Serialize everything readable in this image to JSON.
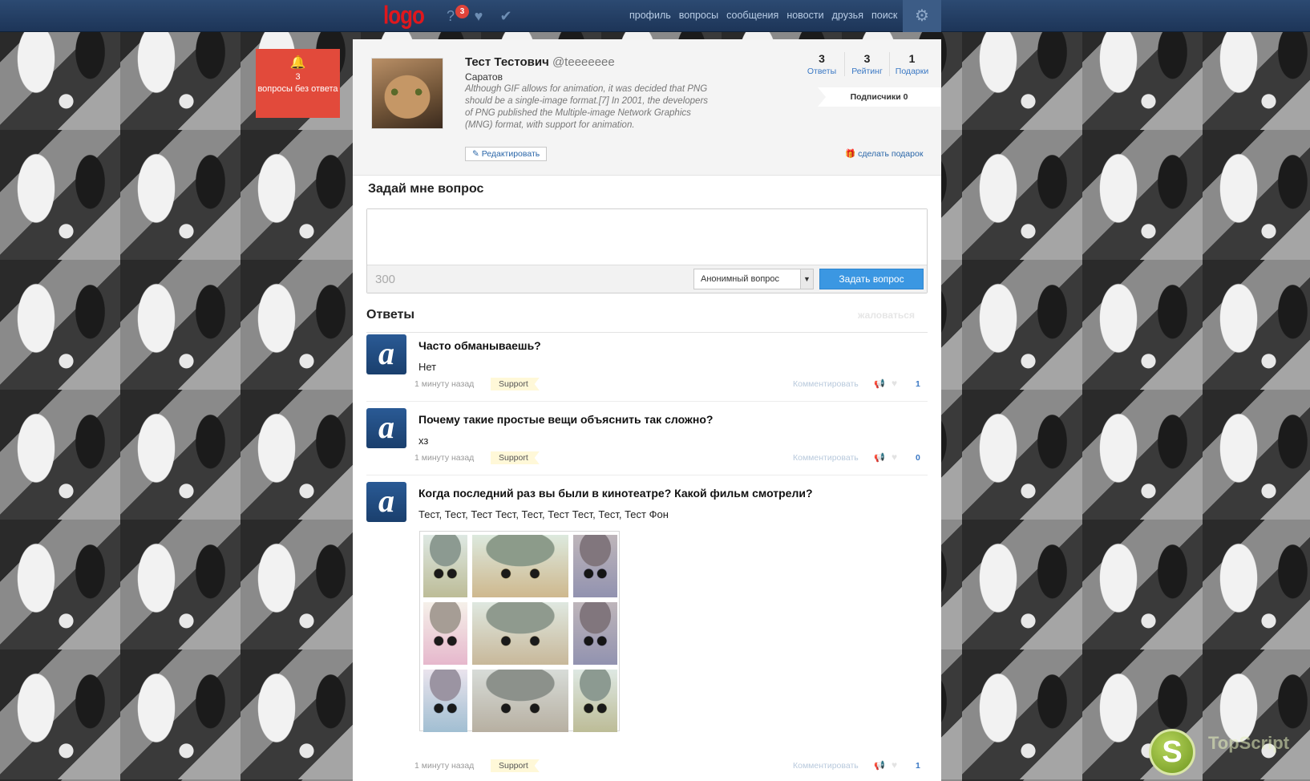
{
  "header": {
    "logo": "logo",
    "notification_count": "3",
    "nav": [
      "профиль",
      "вопросы",
      "сообщения",
      "новости",
      "друзья",
      "поиск"
    ],
    "icons": [
      "question-icon",
      "heart-icon",
      "checkmark-icon",
      "gear-icon"
    ]
  },
  "alert": {
    "count": "3",
    "text": "вопросы без ответа"
  },
  "profile": {
    "name": "Тест Тестович",
    "handle": "@teeeeeee",
    "city": "Саратов",
    "bio": "Although GIF allows for animation, it was decided that PNG should be a single-image format.[7] In 2001, the developers of PNG published the Multiple-image Network Graphics (MNG) format, with support for animation.",
    "edit_label": "Редактировать",
    "stats": [
      {
        "num": "3",
        "label": "Ответы"
      },
      {
        "num": "3",
        "label": "Рейтинг"
      },
      {
        "num": "1",
        "label": "Подарки"
      }
    ],
    "subscribers": "Подписчики 0",
    "gift_label": "сделать подарок"
  },
  "ask": {
    "title": "Задай мне вопрос",
    "placeholder": "",
    "counter": "300",
    "mode": "Анонимный вопрос",
    "submit": "Задать вопрос"
  },
  "answers": {
    "title": "Ответы",
    "report": "жаловаться",
    "items": [
      {
        "question": "Часто обманываешь?",
        "answer": "Нет",
        "time": "1 минуту назад",
        "tag": "Support",
        "comment": "Комментировать",
        "likes": "1"
      },
      {
        "question": "Почему такие простые вещи объяснить так сложно?",
        "answer": "хз",
        "time": "1 минуту назад",
        "tag": "Support",
        "comment": "Комментировать",
        "likes": "0"
      },
      {
        "question": "Когда последний раз вы были в кинотеатре? Какой фильм смотрели?",
        "answer": "Тест, Тест, Тест Тест, Тест, Тест Тест, Тест, Тест Фон",
        "time": "1 минуту назад",
        "tag": "Support",
        "comment": "Комментировать",
        "likes": "1"
      }
    ]
  },
  "watermark": {
    "letter": "S",
    "text": "TopScript"
  }
}
